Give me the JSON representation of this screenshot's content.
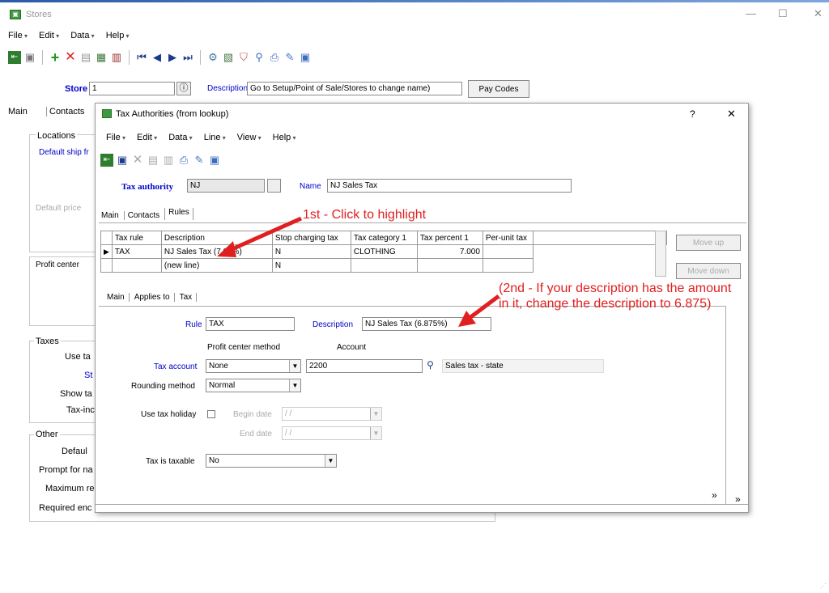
{
  "window": {
    "title": "Stores",
    "minimize": "—",
    "maximize": "☐",
    "close": "✕"
  },
  "menu": [
    "File",
    "Edit",
    "Data",
    "Help"
  ],
  "store": {
    "label": "Store",
    "value": "1",
    "desc_label": "Description",
    "desc_value": "Go to Setup/Point of Sale/Stores to change name)",
    "paycodes": "Pay Codes"
  },
  "bg_tabs": [
    "Main",
    "Contacts"
  ],
  "bg": {
    "locations": "Locations",
    "default_ship": "Default ship fr",
    "default_price": "Default price",
    "profit_center": "Profit center",
    "taxes": "Taxes",
    "use_tax": "Use ta",
    "st": "St",
    "show_tax": "Show ta",
    "tax_inc": "Tax-inc",
    "other": "Other",
    "default": "Defaul",
    "prompt": "Prompt for na",
    "maximum": "Maximum re",
    "required": "Required enc"
  },
  "dialog": {
    "title": "Tax Authorities (from lookup)",
    "help": "?",
    "close": "✕",
    "menu": [
      "File",
      "Edit",
      "Data",
      "Line",
      "View",
      "Help"
    ],
    "tax_authority_label": "Tax authority",
    "tax_authority_value": "NJ",
    "name_label": "Name",
    "name_value": "NJ Sales Tax",
    "tabs": [
      "Main",
      "Contacts",
      "Rules"
    ],
    "grid": {
      "headers": [
        "Tax rule",
        "Description",
        "Stop charging tax",
        "Tax category 1",
        "Tax percent 1",
        "Per-unit tax"
      ],
      "rows": [
        [
          "TAX",
          "NJ Sales Tax (7.00%)",
          "N",
          "CLOTHING",
          "7.000",
          ""
        ],
        [
          "",
          "(new line)",
          "N",
          "",
          "",
          ""
        ]
      ]
    },
    "move_up": "Move up",
    "move_down": "Move down",
    "sub_tabs": [
      "Main",
      "Applies to",
      "Tax"
    ],
    "rule_label": "Rule",
    "rule_value": "TAX",
    "desc_label": "Description",
    "desc_value": "NJ Sales Tax (6.875%)",
    "pcm_header": "Profit center method",
    "account_header": "Account",
    "tax_account_label": "Tax account",
    "tax_account_method": "None",
    "tax_account_value": "2200",
    "tax_account_desc": "Sales tax - state",
    "rounding_label": "Rounding method",
    "rounding_value": "Normal",
    "holiday_label": "Use tax holiday",
    "begin_label": "Begin date",
    "begin_value": "/ /",
    "end_label": "End date",
    "end_value": "/ /",
    "taxable_label": "Tax is taxable",
    "taxable_value": "No",
    "nav": "»"
  },
  "annotations": {
    "first": "1st - Click to highlight",
    "second": "(2nd - If your description has the amount in it, change the description to 6.875)"
  }
}
